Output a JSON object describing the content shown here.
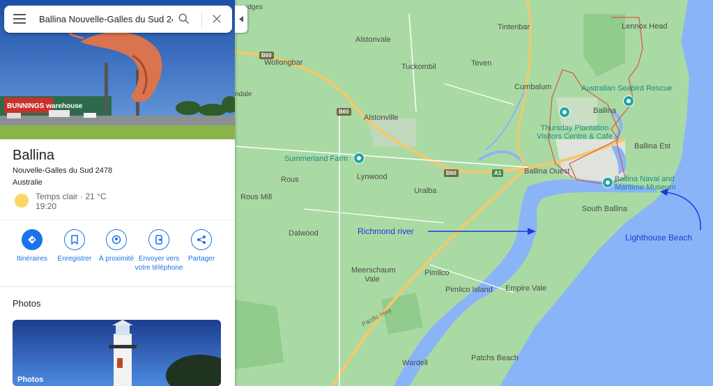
{
  "search": {
    "value": "Ballina Nouvelle-Galles du Sud 24"
  },
  "place": {
    "title": "Ballina",
    "region": "Nouvelle-Galles du Sud 2478",
    "country": "Australie",
    "weather": "Temps clair · 21 °C",
    "time": "19:20",
    "hero_sign": "BUNNINGS warehouse"
  },
  "actions": [
    {
      "label": "Itinéraires",
      "icon": "directions-icon"
    },
    {
      "label": "Enregistrer",
      "icon": "bookmark-icon"
    },
    {
      "label": "À proximité",
      "icon": "nearby-icon"
    },
    {
      "label": "Envoyer vers votre téléphone",
      "icon": "send-to-phone-icon"
    },
    {
      "label": "Partager",
      "icon": "share-icon"
    }
  ],
  "photos": {
    "title": "Photos",
    "card_label": "Photos"
  },
  "map": {
    "places": [
      "Tintenbar",
      "Lennox Head",
      "Alstonvale",
      "Wollongbar",
      "Tuckombil",
      "Teven",
      "Cumbalum",
      "Ballina",
      "Alstonville",
      "Ballina Est",
      "Lynwood",
      "Rous",
      "Uralba",
      "Ballina Ouest",
      "Rous Mill",
      "South Ballina",
      "Dalwood",
      "Meerschaum Vale",
      "Pimlico",
      "Pimlico Island",
      "Empire Vale",
      "Wardell",
      "Patchs Beach",
      "ndale",
      "idges"
    ],
    "pois": [
      "Australian Seabird Rescue",
      "Thursday Plantation Visitors Centre & Cafe",
      "Summerland Farm",
      "Ballina Naval and Maritime Museum"
    ],
    "road_shields": [
      "B60",
      "B60",
      "B60",
      "A1"
    ],
    "road_names": [
      "Pacific Hwy"
    ],
    "annotations": {
      "river": "Richmond river",
      "beach": "Lighthouse Beach"
    }
  },
  "colors": {
    "land": "#aadaa4",
    "water": "#8ab4f8",
    "accent": "#1a73e8",
    "annotation": "#1a39d9",
    "boundary": "#d9534f"
  }
}
